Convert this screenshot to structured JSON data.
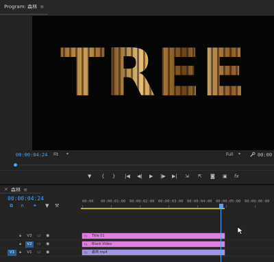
{
  "monitor": {
    "title": "Program: 森林",
    "menu_glyph": "≡",
    "video_text": "TREE",
    "timecode": "00:00:04:24",
    "fit_label": "Fit",
    "full_label": "Full",
    "timecode_right": "00:00"
  },
  "transport": {
    "buttons": [
      "marker",
      "mark-in",
      "mark-out",
      "go-to-in",
      "step-back",
      "play",
      "step-forward",
      "go-to-out",
      "insert",
      "overwrite",
      "export-frame",
      "comparison",
      "fx"
    ],
    "glyphs": {
      "marker": "▼",
      "mark_in": "{",
      "mark_out": "}",
      "go_to_in": "|◀",
      "step_back": "◀|",
      "play": "▶",
      "step_forward": "|▶",
      "go_to_out": "▶|",
      "insert": "⇲",
      "overwrite": "⇱",
      "export_frame": "◙",
      "comparison": "▣",
      "fx": "fx"
    }
  },
  "timeline": {
    "close_glyph": "×",
    "title": "森林",
    "menu_glyph": "≡",
    "timecode": "00:00:04:24",
    "ruler_labels": [
      "00:00",
      "00:00:01:00",
      "00:00:02:00",
      "00:00:03:00",
      "00:00:04:00",
      "00:00:05:00",
      "00:00:06:00"
    ],
    "tracks": [
      {
        "id": "V3",
        "clip_label": "Title 01",
        "clip_color": "#e07fdf"
      },
      {
        "id": "V2",
        "clip_label": "Black Video",
        "clip_color": "#e07fdf"
      },
      {
        "id": "V1",
        "clip_label": "森林.mp4",
        "clip_color": "#a292e2"
      }
    ],
    "source_patch": "V1",
    "fx_badge": "fx"
  },
  "colors": {
    "accent": "#4aa3ff",
    "work_area": "#b7b324"
  }
}
